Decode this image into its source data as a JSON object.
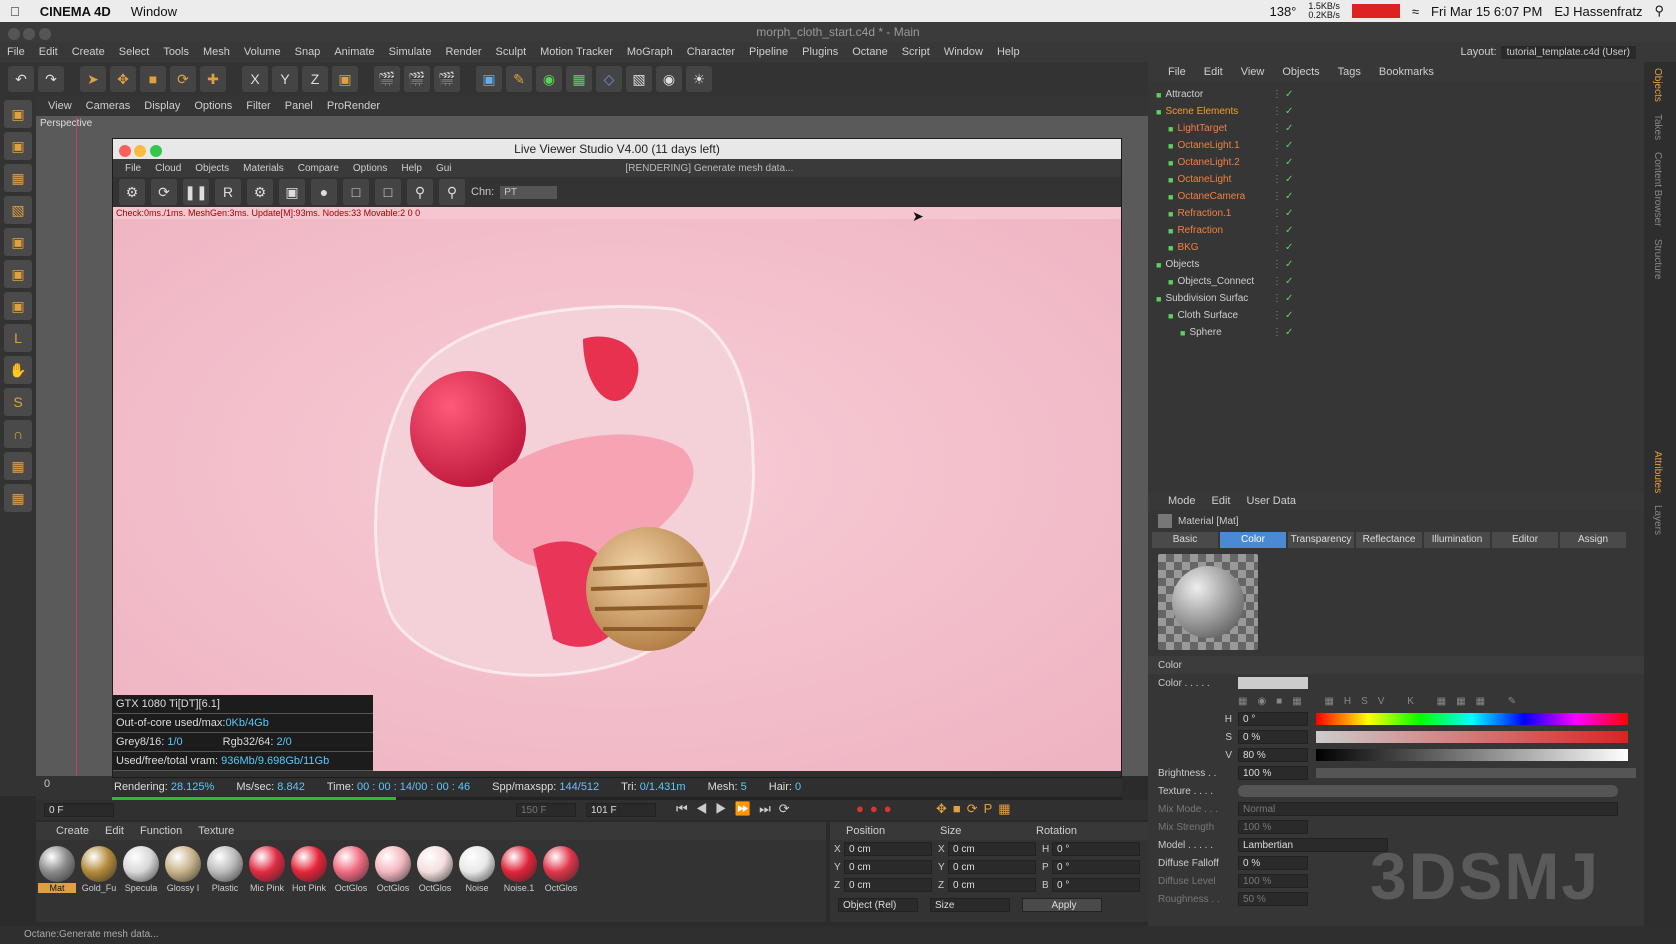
{
  "macbar": {
    "apple": "",
    "app_name": "CINEMA 4D",
    "menu": "Window",
    "cpu_temp": "138°",
    "net_up": "1.5KB/s",
    "net_down": "0.2KB/s",
    "clock": "Fri Mar 15  6:07 PM",
    "user": "EJ Hassenfratz"
  },
  "window_title": "morph_cloth_start.c4d * - Main",
  "menubar": [
    "File",
    "Edit",
    "Create",
    "Select",
    "Tools",
    "Mesh",
    "Volume",
    "Snap",
    "Animate",
    "Simulate",
    "Render",
    "Sculpt",
    "Motion Tracker",
    "MoGraph",
    "Character",
    "Pipeline",
    "Plugins",
    "Octane",
    "Script",
    "Window",
    "Help"
  ],
  "layout": {
    "label": "Layout:",
    "value": "tutorial_template.c4d (User)"
  },
  "viewport": {
    "menu": [
      "View",
      "Cameras",
      "Display",
      "Options",
      "Filter",
      "Panel",
      "ProRender"
    ],
    "label": "Perspective"
  },
  "live_viewer": {
    "title": "Live Viewer Studio V4.00 (11 days left)",
    "menu": [
      "File",
      "Cloud",
      "Objects",
      "Materials",
      "Compare",
      "Options",
      "Help",
      "Gui"
    ],
    "render_status": "[RENDERING] Generate mesh data...",
    "chn_label": "Chn:",
    "chn_value": "PT",
    "status_line": "Check:0ms./1ms. MeshGen:3ms. Update[M]:93ms. Nodes:33 Movable:2  0 0",
    "stats": {
      "gpu": "GTX 1080 Ti[DT][6.1]",
      "ooc_label": "Out-of-core used/max:",
      "ooc_value": "0Kb/4Gb",
      "grey_label": "Grey8/16:",
      "grey_value": "1/0",
      "rgb_label": "Rgb32/64:",
      "rgb_value": "2/0",
      "vram_label": "Used/free/total vram:",
      "vram_value": "936Mb/9.698Gb/11Gb"
    },
    "bottom": {
      "rendering_label": "Rendering:",
      "rendering_value": "28.125%",
      "mssec_label": "Ms/sec:",
      "mssec_value": "8.842",
      "time_label": "Time:",
      "time_value": "00 : 00 : 14/00 : 00 : 46",
      "spp_label": "Spp/maxspp:",
      "spp_value": "144/512",
      "tri_label": "Tri:",
      "tri_value": "0/1.431m",
      "mesh_label": "Mesh:",
      "mesh_value": "5",
      "hair_label": "Hair:",
      "hair_value": "0"
    },
    "progress": 0.28125
  },
  "timeline": {
    "start": "0",
    "frame_field": "0 F",
    "end_field": "101 F",
    "range_end": "150 F"
  },
  "materials": {
    "menu": [
      "Create",
      "Edit",
      "Function",
      "Texture"
    ],
    "items": [
      {
        "label": "Mat",
        "color": "#8a8a8a"
      },
      {
        "label": "Gold_Fu",
        "color": "#b38a3a"
      },
      {
        "label": "Specula",
        "color": "#d8d8d8"
      },
      {
        "label": "Glossy I",
        "color": "#c7b38a"
      },
      {
        "label": "Plastic",
        "color": "#bbbbbb"
      },
      {
        "label": "Mic Pink",
        "color": "#e02a43"
      },
      {
        "label": "Hot Pink",
        "color": "#e5243a"
      },
      {
        "label": "OctGlos",
        "color": "#f06a80"
      },
      {
        "label": "OctGlos",
        "color": "#f4b8c0"
      },
      {
        "label": "OctGlos",
        "color": "#f5dede"
      },
      {
        "label": "Noise",
        "color": "#e8e8e8"
      },
      {
        "label": "Noise.1",
        "color": "#e0243a"
      },
      {
        "label": "OctGlos",
        "color": "#e0354a"
      }
    ]
  },
  "coords": {
    "headers": [
      "Position",
      "Size",
      "Rotation"
    ],
    "rows": [
      {
        "axis": "X",
        "pos": "0 cm",
        "saxis": "X",
        "size": "0 cm",
        "raxis": "H",
        "rot": "0 °"
      },
      {
        "axis": "Y",
        "pos": "0 cm",
        "saxis": "Y",
        "size": "0 cm",
        "raxis": "P",
        "rot": "0 °"
      },
      {
        "axis": "Z",
        "pos": "0 cm",
        "saxis": "Z",
        "size": "0 cm",
        "raxis": "B",
        "rot": "0 °"
      }
    ],
    "mode": "Object (Rel)",
    "size_mode": "Size",
    "apply": "Apply"
  },
  "objects": {
    "menu": [
      "File",
      "Edit",
      "View",
      "Objects",
      "Tags",
      "Bookmarks"
    ],
    "rows": [
      {
        "name": "Attractor",
        "color": "#cfcfcf",
        "indent": 0
      },
      {
        "name": "Scene Elements",
        "color": "#f0a020",
        "indent": 0
      },
      {
        "name": "LightTarget",
        "color": "#f08040",
        "indent": 1
      },
      {
        "name": "OctaneLight.1",
        "color": "#f08040",
        "indent": 1
      },
      {
        "name": "OctaneLight.2",
        "color": "#f08040",
        "indent": 1
      },
      {
        "name": "OctaneLight",
        "color": "#f08040",
        "indent": 1
      },
      {
        "name": "OctaneCamera",
        "color": "#f08040",
        "indent": 1
      },
      {
        "name": "Refraction.1",
        "color": "#f08040",
        "indent": 1
      },
      {
        "name": "Refraction",
        "color": "#f08040",
        "indent": 1
      },
      {
        "name": "BKG",
        "color": "#f08040",
        "indent": 1
      },
      {
        "name": "Objects",
        "color": "#cfcfcf",
        "indent": 0
      },
      {
        "name": "Objects_Connect",
        "color": "#cfcfcf",
        "indent": 1
      },
      {
        "name": "Subdivision Surfac",
        "color": "#cfcfcf",
        "indent": 0
      },
      {
        "name": "Cloth Surface",
        "color": "#cfcfcf",
        "indent": 1
      },
      {
        "name": "Sphere",
        "color": "#cfcfcf",
        "indent": 2
      }
    ]
  },
  "attributes": {
    "menu": [
      "Mode",
      "Edit",
      "User Data"
    ],
    "material_title": "Material [Mat]",
    "tabs": [
      "Basic",
      "Color",
      "Transparency",
      "Reflectance",
      "Illumination",
      "Editor",
      "Assign"
    ],
    "active_tab": "Color",
    "section": "Color",
    "color_label": "Color . . . . .",
    "h_label": "H",
    "h_value": "0 °",
    "s_label": "S",
    "s_value": "0 %",
    "v_label": "V",
    "v_value": "80 %",
    "brightness_label": "Brightness . .",
    "brightness_value": "100 %",
    "texture_label": "Texture . . . .",
    "mixmode_label": "Mix Mode . . .",
    "mixmode_value": "Normal",
    "mixstrength_label": "Mix Strength",
    "mixstrength_value": "100 %",
    "model_label": "Model . . . . .",
    "model_value": "Lambertian",
    "falloff_label": "Diffuse Falloff",
    "falloff_value": "0 %",
    "difflevel_label": "Diffuse Level",
    "difflevel_value": "100 %",
    "roughness_label": "Roughness . .",
    "roughness_value": "50 %"
  },
  "right_tabs": [
    "Objects",
    "Takes",
    "Content Browser",
    "Structure",
    "Attributes",
    "Layers"
  ],
  "statusbar": "Octane:Generate mesh data...",
  "watermark": "3DSMJ"
}
